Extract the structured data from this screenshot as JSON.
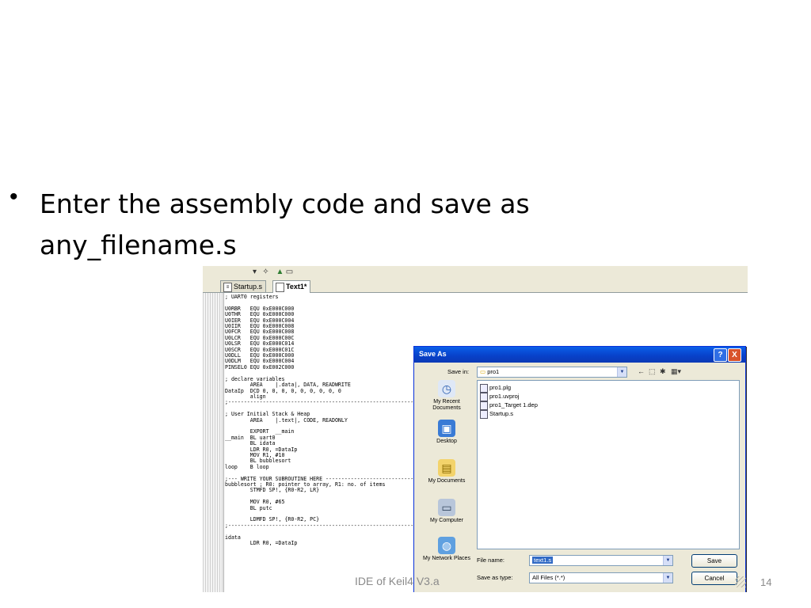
{
  "slide": {
    "bullet_line1": "Enter the assembly code and save as",
    "bullet_line2": "any_filename.s",
    "footer": "IDE of Keil4 V3.a",
    "page_number": "14"
  },
  "editor": {
    "tabs": [
      {
        "label": "Startup.s",
        "active": false
      },
      {
        "label": "Text1*",
        "active": true
      }
    ],
    "code": "; UART0 registers\n\nU0RBR   EQU 0xE000C000\nU0THR   EQU 0xE000C000\nU0IER   EQU 0xE000C004\nU0IIR   EQU 0xE000C008\nU0FCR   EQU 0xE000C008\nU0LCR   EQU 0xE000C00C\nU0LSR   EQU 0xE000C014\nU0SCR   EQU 0xE000C01C\nU0DLL   EQU 0xE000C000\nU0DLM   EQU 0xE000C004\nPINSEL0 EQU 0xE002C000\n\n; declare variables\n        AREA    |.data|, DATA, READWRITE\nDataIp  DCD 0, 0, 0, 0, 0, 0, 0, 0, 0\n        align\n;-----------------------------------------------------------------------\n\n; User Initial Stack & Heap\n        AREA    |.text|, CODE, READONLY\n\n        EXPORT  __main\n__main  BL uart0\n        BL idata\n        LDR R0, =DataIp\n        MOV R1, #10\n        BL bubblesort\nloop    B loop\n\n;--- WRITE YOUR SUBROUTINE HERE -----------------------------------------\nbubblesort ; R0: pointer to array, R1: no. of items\n        STMFD SP!, {R0-R2, LR}\n\n        MOV R0, #65\n        BL putc\n\n        LDMFD SP!, {R0-R2, PC}\n;-----------------------------------------------------------------------\n\nidata\n        LDR R0, =DataIp"
  },
  "dialog": {
    "title": "Save As",
    "save_in_label": "Save in:",
    "save_in_value": "pro1",
    "places": [
      {
        "label": "My Recent Documents",
        "icon": "recent-documents-icon"
      },
      {
        "label": "Desktop",
        "icon": "desktop-icon"
      },
      {
        "label": "My Documents",
        "icon": "my-documents-icon"
      },
      {
        "label": "My Computer",
        "icon": "my-computer-icon"
      },
      {
        "label": "My Network Places",
        "icon": "network-places-icon"
      }
    ],
    "files": [
      "pro1.plg",
      "pro1.uvproj",
      "pro1_Target 1.dep",
      "Startup.s"
    ],
    "file_name_label": "File name:",
    "file_name_value": "text1.s",
    "save_as_type_label": "Save as type:",
    "save_as_type_value": "All Files (*.*)",
    "save_button": "Save",
    "cancel_button": "Cancel",
    "help_button": "?",
    "close_button": "X"
  }
}
